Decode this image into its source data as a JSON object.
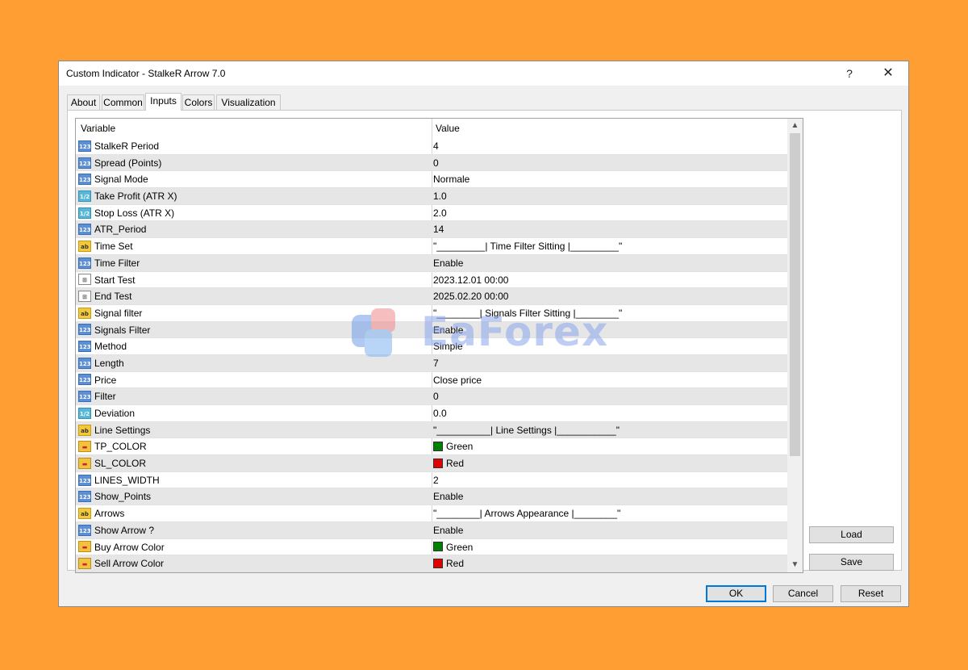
{
  "window": {
    "title": "Custom Indicator - StalkeR Arrow 7.0",
    "help_label": "?",
    "close_label": "✕"
  },
  "tabs": [
    {
      "label": "About"
    },
    {
      "label": "Common"
    },
    {
      "label": "Inputs",
      "active": true
    },
    {
      "label": "Colors"
    },
    {
      "label": "Visualization"
    }
  ],
  "grid": {
    "headers": {
      "variable": "Variable",
      "value": "Value"
    },
    "rows": [
      {
        "type": "int",
        "name": "StalkeR Period",
        "value": "4"
      },
      {
        "type": "int",
        "name": "Spread (Points)",
        "value": "0"
      },
      {
        "type": "int",
        "name": "Signal Mode",
        "value": "Normale"
      },
      {
        "type": "dbl",
        "name": "Take Profit (ATR X)",
        "value": "1.0"
      },
      {
        "type": "dbl",
        "name": "Stop Loss (ATR X)",
        "value": "2.0"
      },
      {
        "type": "int",
        "name": "ATR_Period",
        "value": "14"
      },
      {
        "type": "str",
        "name": "Time Set",
        "value": "\"_________| Time Filter Sitting |_________\""
      },
      {
        "type": "int",
        "name": "Time Filter",
        "value": "Enable"
      },
      {
        "type": "dt",
        "name": "Start Test",
        "value": "2023.12.01 00:00"
      },
      {
        "type": "dt",
        "name": "End Test",
        "value": "2025.02.20 00:00"
      },
      {
        "type": "str",
        "name": "Signal filter",
        "value": "\"________| Signals Filter Sitting |________\""
      },
      {
        "type": "int",
        "name": "Signals Filter",
        "value": "Enable"
      },
      {
        "type": "int",
        "name": "Method",
        "value": "Simple"
      },
      {
        "type": "int",
        "name": "Length",
        "value": "7"
      },
      {
        "type": "int",
        "name": "Price",
        "value": "Close price"
      },
      {
        "type": "int",
        "name": "Filter",
        "value": "0"
      },
      {
        "type": "dbl",
        "name": "Deviation",
        "value": "0.0"
      },
      {
        "type": "str",
        "name": "Line Settings",
        "value": "\"__________| Line Settings |___________\""
      },
      {
        "type": "clr",
        "name": "TP_COLOR",
        "value": "Green",
        "swatch": "#008000"
      },
      {
        "type": "clr",
        "name": "SL_COLOR",
        "value": "Red",
        "swatch": "#e00000"
      },
      {
        "type": "int",
        "name": "LINES_WIDTH",
        "value": "2"
      },
      {
        "type": "int",
        "name": "Show_Points",
        "value": "Enable"
      },
      {
        "type": "str",
        "name": "Arrows",
        "value": "\"________| Arrows Appearance |________\""
      },
      {
        "type": "int",
        "name": "Show Arrow ?",
        "value": "Enable"
      },
      {
        "type": "clr",
        "name": "Buy Arrow Color",
        "value": "Green",
        "swatch": "#008000"
      },
      {
        "type": "clr",
        "name": "Sell Arrow Color",
        "value": "Red",
        "swatch": "#e00000"
      }
    ]
  },
  "type_icons": {
    "int": "123",
    "dbl": "1/2",
    "str": "ab",
    "dt": "⊞",
    "clr": "▬"
  },
  "side_buttons": {
    "load": "Load",
    "save": "Save"
  },
  "footer_buttons": {
    "ok": "OK",
    "cancel": "Cancel",
    "reset": "Reset"
  },
  "watermark": {
    "text": "EaForex"
  },
  "colors": {
    "background": "#ff9e33",
    "row_alt": "#e6e6e6",
    "accent": "#0078d7"
  }
}
